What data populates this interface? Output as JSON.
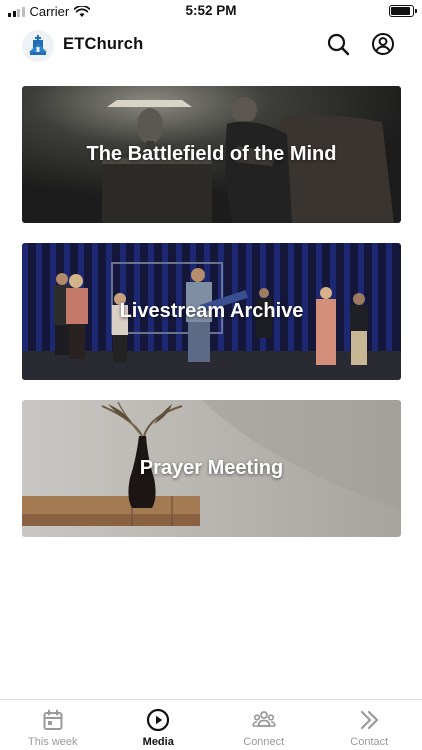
{
  "status_bar": {
    "carrier": "Carrier",
    "time": "5:52 PM"
  },
  "header": {
    "app_name": "ETChurch",
    "search_icon": "search-icon",
    "profile_icon": "profile-icon"
  },
  "cards": [
    {
      "title": "The Battlefield of the Mind"
    },
    {
      "title": "Livestream Archive"
    },
    {
      "title": "Prayer Meeting"
    }
  ],
  "tabs": [
    {
      "label": "This week",
      "icon": "calendar-icon",
      "active": false
    },
    {
      "label": "Media",
      "icon": "play-circle-icon",
      "active": true
    },
    {
      "label": "Connect",
      "icon": "people-icon",
      "active": false
    },
    {
      "label": "Contact",
      "icon": "chevrons-right-icon",
      "active": false
    }
  ],
  "colors": {
    "active_tab": "#111111",
    "inactive_tab": "#9a9a9a",
    "logo_blue": "#1f6fb5"
  }
}
